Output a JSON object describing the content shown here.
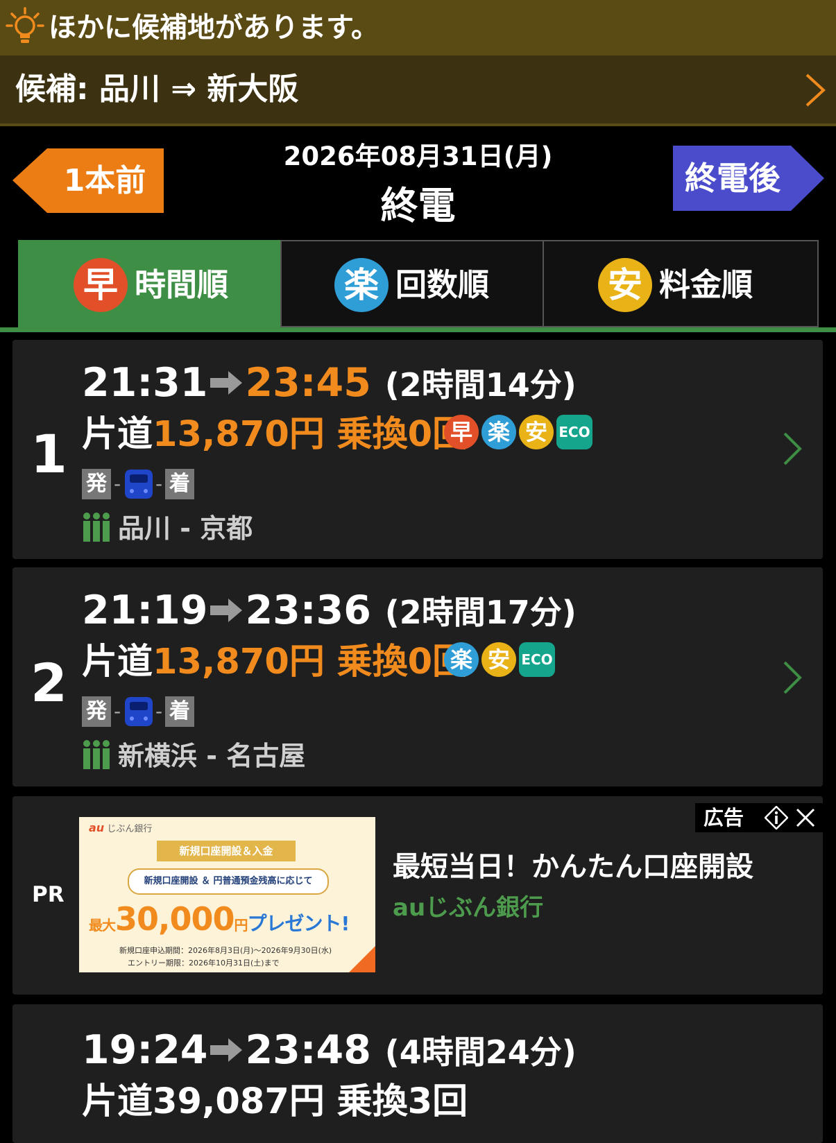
{
  "alert": {
    "text": "ほかに候補地があります。"
  },
  "candidate": {
    "text": "候補: 品川 ⇒ 新大阪"
  },
  "nav": {
    "prev_label": "1本前",
    "next_label": "終電後",
    "date": "2026年08月31日(月)",
    "mode": "終電"
  },
  "tabs": [
    {
      "icon_char": "早",
      "label": "時間順",
      "active": true
    },
    {
      "icon_char": "楽",
      "label": "回数順",
      "active": false
    },
    {
      "icon_char": "安",
      "label": "料金順",
      "active": false
    }
  ],
  "routes": [
    {
      "rank": "1",
      "depart": "21:31",
      "arrive": "23:45",
      "duration": "(2時間14分)",
      "fare_prefix": "片道",
      "fare": "13,870円",
      "transfers": "乗換0回",
      "badges": [
        "早",
        "楽",
        "安",
        "ECO"
      ],
      "dep_label": "発",
      "arr_label": "着",
      "dash": "-",
      "section": "品川 - 京都"
    },
    {
      "rank": "2",
      "depart": "21:19",
      "arrive": "23:36",
      "duration": "(2時間17分)",
      "fare_prefix": "片道",
      "fare": "13,870円",
      "transfers": "乗換0回",
      "badges": [
        "楽",
        "安",
        "ECO"
      ],
      "dep_label": "発",
      "arr_label": "着",
      "dash": "-",
      "section": "新横浜 - 名古屋"
    },
    {
      "depart": "19:24",
      "arrive": "23:48",
      "duration": "(4時間24分)",
      "fare_prefix": "片道",
      "fare": "39,087円",
      "transfers": "乗換3回"
    }
  ],
  "ad": {
    "pr_label": "PR",
    "tag_label": "広告",
    "title": "最短当日！かんたん口座開設",
    "sponsor": "auじぶん銀行",
    "banner": {
      "brand_mark": "au",
      "brand": "じぶん銀行",
      "ribbon": "新規口座開設＆入金",
      "pill": "新規口座開設 ＆ 円普通預金残高に応じて",
      "amount_prefix": "最大",
      "amount": "30,000",
      "amount_unit": "円",
      "present": "プレゼント!",
      "period": "新規口座申込期間：2026年8月3日(月)～2026年9月30日(水)",
      "entry": "エントリー期限：2026年10月31日(土)まで"
    }
  },
  "colors": {
    "alert_bg": "#5a4b14",
    "accent_orange": "#f18b1e",
    "prev_button": "#ec7d14",
    "next_button": "#4a4ccc",
    "active_tab": "#3e8e46",
    "badge_fast": "#e2502a",
    "badge_easy": "#2f9ed6",
    "badge_cheap": "#e9b216",
    "badge_eco": "#14a58c",
    "card_bg": "#1f1f1f"
  },
  "icons": {
    "alert": "lightbulb-icon",
    "chevron": "chevron-right-icon",
    "train": "shinkansen-icon",
    "section": "people-icon",
    "ad_info": "info-icon",
    "ad_close": "close-icon"
  }
}
